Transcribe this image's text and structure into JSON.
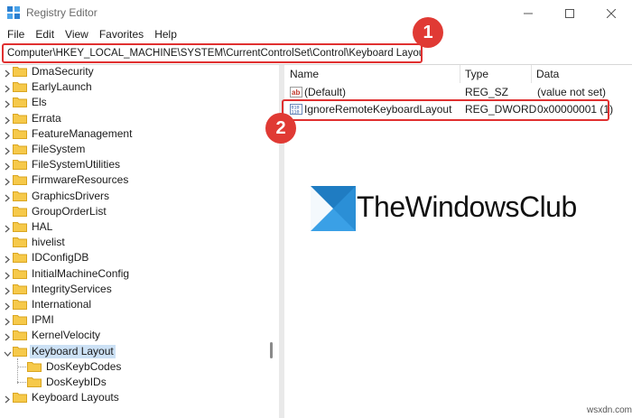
{
  "window": {
    "title": "Registry Editor",
    "icon": "registry-icon"
  },
  "menu": [
    "File",
    "Edit",
    "View",
    "Favorites",
    "Help"
  ],
  "address": {
    "path": "Computer\\HKEY_LOCAL_MACHINE\\SYSTEM\\CurrentControlSet\\Control\\Keyboard Layout"
  },
  "tree": {
    "items": [
      {
        "label": "DmaSecurity",
        "expandable": true
      },
      {
        "label": "EarlyLaunch",
        "expandable": true
      },
      {
        "label": "Els",
        "expandable": true
      },
      {
        "label": "Errata",
        "expandable": true
      },
      {
        "label": "FeatureManagement",
        "expandable": true
      },
      {
        "label": "FileSystem",
        "expandable": true
      },
      {
        "label": "FileSystemUtilities",
        "expandable": true
      },
      {
        "label": "FirmwareResources",
        "expandable": true
      },
      {
        "label": "GraphicsDrivers",
        "expandable": true
      },
      {
        "label": "GroupOrderList",
        "expandable": false
      },
      {
        "label": "HAL",
        "expandable": true
      },
      {
        "label": "hivelist",
        "expandable": false
      },
      {
        "label": "IDConfigDB",
        "expandable": true
      },
      {
        "label": "InitialMachineConfig",
        "expandable": true
      },
      {
        "label": "IntegrityServices",
        "expandable": true
      },
      {
        "label": "International",
        "expandable": true
      },
      {
        "label": "IPMI",
        "expandable": true
      },
      {
        "label": "KernelVelocity",
        "expandable": true
      },
      {
        "label": "Keyboard Layout",
        "expandable": true,
        "expanded": true,
        "selected": true
      },
      {
        "label": "DosKeybCodes",
        "child": true
      },
      {
        "label": "DosKeybIDs",
        "child": true
      },
      {
        "label": "Keyboard Layouts",
        "expandable": true
      }
    ]
  },
  "values": {
    "headers": {
      "name": "Name",
      "type": "Type",
      "data": "Data"
    },
    "rows": [
      {
        "name": "(Default)",
        "type": "REG_SZ",
        "data": "(value not set)",
        "icon": "string-value-icon"
      },
      {
        "name": "IgnoreRemoteKeyboardLayout",
        "type": "REG_DWORD",
        "data": "0x00000001 (1)",
        "icon": "binary-value-icon"
      }
    ]
  },
  "annotations": {
    "badge1": "1",
    "badge2": "2"
  },
  "watermark": {
    "text": "TheWindowsClub"
  },
  "footer": {
    "text": "wsxdn.com"
  },
  "colors": {
    "highlight_red": "#e03030",
    "badge_red": "#e03a34",
    "folder_yellow": "#f6c94a",
    "selection_blue": "#cce1f5",
    "logo_blue": "#2b8fd6"
  }
}
